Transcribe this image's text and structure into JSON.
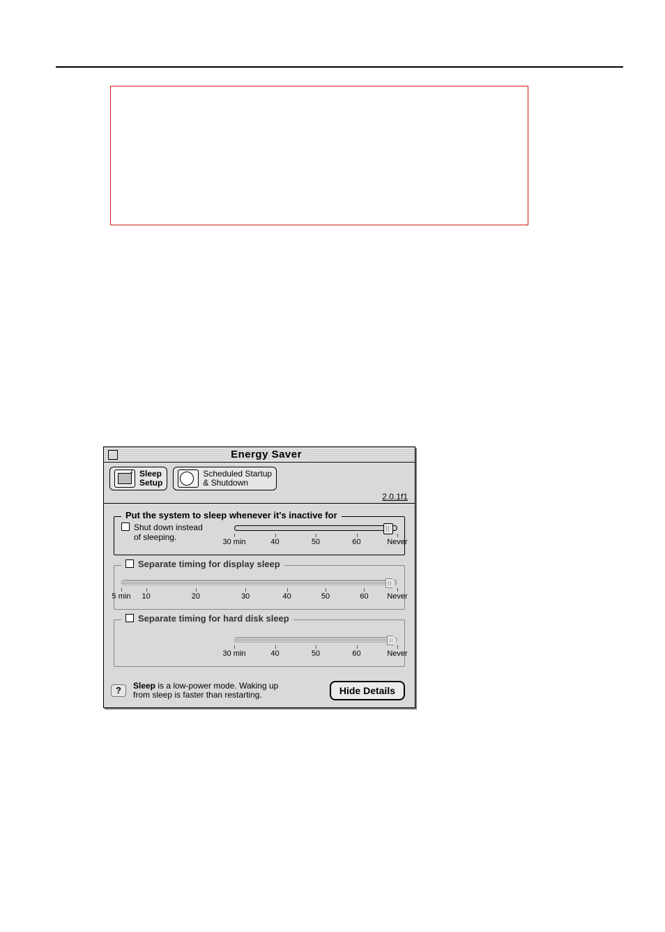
{
  "window": {
    "title": "Energy Saver",
    "version": "2.0.1f1",
    "tabs": {
      "sleep_setup_label": "Sleep\nSetup",
      "scheduled_label": "Scheduled Startup\n& Shutdown"
    }
  },
  "group_system": {
    "legend": "Put the system to sleep whenever it's inactive for",
    "shutdown_checkbox_label": "Shut down instead\nof sleeping.",
    "ticks": [
      "30 min",
      "40",
      "50",
      "60",
      "Never"
    ]
  },
  "group_display": {
    "legend": "Separate timing for display sleep",
    "ticks": [
      "5 min",
      "10",
      "20",
      "30",
      "40",
      "50",
      "60",
      "Never"
    ]
  },
  "group_harddisk": {
    "legend": "Separate timing for hard disk sleep",
    "ticks": [
      "30 min",
      "40",
      "50",
      "60",
      "Never"
    ]
  },
  "footer": {
    "help_symbol": "?",
    "text_bold": "Sleep",
    "text_rest": " is a low-power mode. Waking up\nfrom sleep is faster than restarting.",
    "button_label": "Hide Details"
  }
}
